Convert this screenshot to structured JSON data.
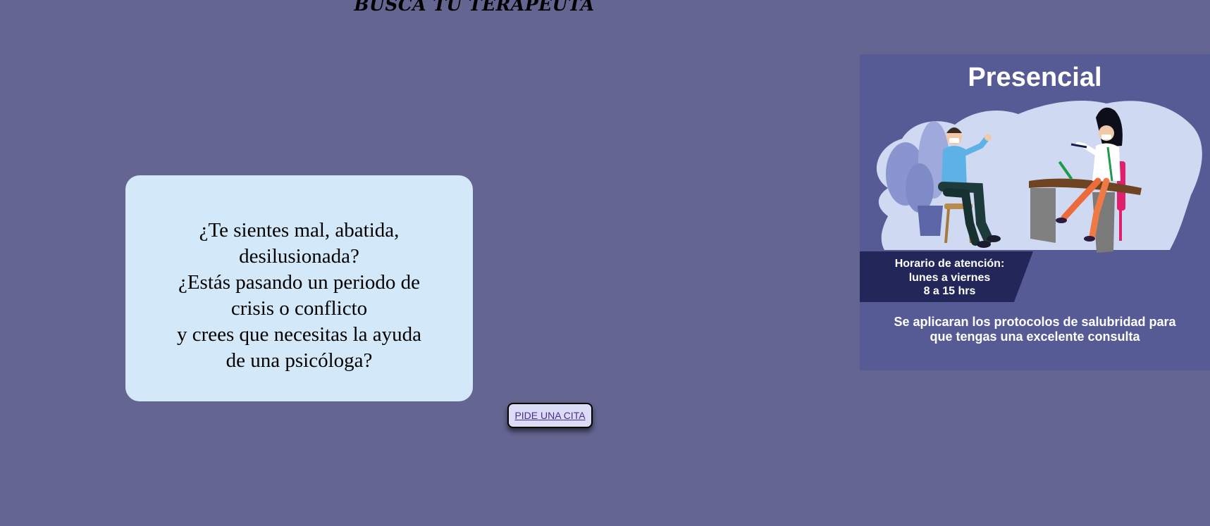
{
  "header": {
    "title": "BUSCA TU TERAPEUTA"
  },
  "message_card": {
    "lines": [
      "¿Te sientes mal, abatida,",
      "desilusionada?",
      "¿Estás pasando un periodo de",
      "crisis o conflicto",
      "y crees que necesitas la ayuda",
      "de una psicóloga?"
    ]
  },
  "cta": {
    "label": "PIDE UNA CITA"
  },
  "promo": {
    "heading": "Presencial",
    "hours": {
      "label": "Horario de atención:",
      "days": "lunes a viernes",
      "time": "8 a 15 hrs"
    },
    "protocol_lines": [
      "Se aplicaran los protocolos de salubridad para",
      "que tengas una excelente consulta"
    ]
  },
  "colors": {
    "background": "#646591",
    "card": "#d3e9f9",
    "banner": "#565a95",
    "hours_box": "#232658",
    "button": "#dcdcf6",
    "link": "#4b2f8e"
  }
}
